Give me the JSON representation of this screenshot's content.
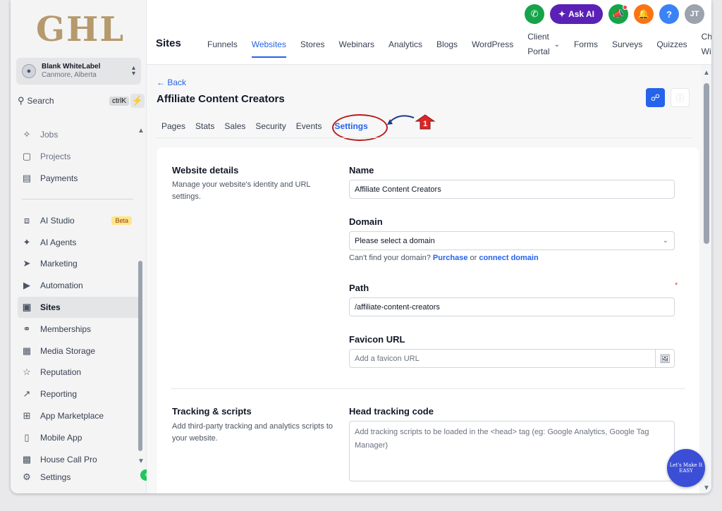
{
  "brand": {
    "logo_text": "GHL"
  },
  "account": {
    "name": "Blank WhiteLabel",
    "location": "Canmore, Alberta"
  },
  "search": {
    "label": "Search",
    "shortcut": "ctrlK"
  },
  "sidebar": {
    "items_top": [
      {
        "label": "Jobs",
        "icon": "jobs-icon"
      },
      {
        "label": "Projects",
        "icon": "projects-icon"
      },
      {
        "label": "Payments",
        "icon": "payments-icon"
      }
    ],
    "items": [
      {
        "label": "AI Studio",
        "icon": "ai-studio-icon",
        "badge": "Beta"
      },
      {
        "label": "AI Agents",
        "icon": "ai-agents-icon"
      },
      {
        "label": "Marketing",
        "icon": "send-icon"
      },
      {
        "label": "Automation",
        "icon": "automation-icon"
      },
      {
        "label": "Sites",
        "icon": "sites-icon",
        "active": true
      },
      {
        "label": "Memberships",
        "icon": "award-icon"
      },
      {
        "label": "Media Storage",
        "icon": "image-icon"
      },
      {
        "label": "Reputation",
        "icon": "star-icon"
      },
      {
        "label": "Reporting",
        "icon": "trend-icon"
      },
      {
        "label": "App Marketplace",
        "icon": "grid-icon"
      },
      {
        "label": "Mobile App",
        "icon": "mobile-icon"
      },
      {
        "label": "House Call Pro",
        "icon": "briefcase-icon"
      },
      {
        "label": "Settings",
        "icon": "gear-icon"
      }
    ]
  },
  "header": {
    "section_title": "Sites",
    "ask_ai": "Ask AI",
    "user_initials": "JT",
    "help": "?",
    "tabs": [
      {
        "label": "Funnels"
      },
      {
        "label": "Websites",
        "active": true
      },
      {
        "label": "Stores"
      },
      {
        "label": "Webinars"
      },
      {
        "label": "Analytics"
      },
      {
        "label": "Blogs"
      },
      {
        "label": "WordPress"
      },
      {
        "label": "Client Portal",
        "line1": "Client",
        "line2": "Portal",
        "dropdown": true
      },
      {
        "label": "Forms"
      },
      {
        "label": "Surveys"
      },
      {
        "label": "Quizzes"
      },
      {
        "label": "Chat Widget",
        "line1": "Cha",
        "line2": "Wid"
      }
    ],
    "colors": {
      "phone": "#16a34a",
      "ask_ai": "#5b21b6",
      "megaphone": "#16a34a",
      "bell": "#f97316",
      "help": "#3b82f6",
      "avatar": "#9ca3af"
    }
  },
  "page": {
    "back_label": "Back",
    "title": "Affiliate Content Creators",
    "subtabs": [
      {
        "label": "Pages"
      },
      {
        "label": "Stats"
      },
      {
        "label": "Sales"
      },
      {
        "label": "Security"
      },
      {
        "label": "Events"
      },
      {
        "label": "Settings",
        "active": true
      }
    ],
    "annotation_number": "1"
  },
  "website_details": {
    "title": "Website details",
    "description": "Manage your website's identity and URL settings.",
    "name_label": "Name",
    "name_value": "Affiliate Content Creators",
    "domain_label": "Domain",
    "domain_placeholder": "Please select a domain",
    "domain_help_prefix": "Can't find your domain?",
    "domain_help_purchase": "Purchase",
    "domain_help_or": "or",
    "domain_help_connect": "connect domain",
    "path_label": "Path",
    "path_required": "*",
    "path_value": "/affiliate-content-creators",
    "favicon_label": "Favicon URL",
    "favicon_placeholder": "Add a favicon URL"
  },
  "tracking": {
    "title": "Tracking & scripts",
    "description": "Add third-party tracking and analytics scripts to your website.",
    "head_label": "Head tracking code",
    "head_placeholder": "Add tracking scripts to be loaded in the <head> tag (eg: Google Analytics, Google Tag Manager)"
  },
  "watermark": {
    "text": "Let's Make It EASY"
  }
}
